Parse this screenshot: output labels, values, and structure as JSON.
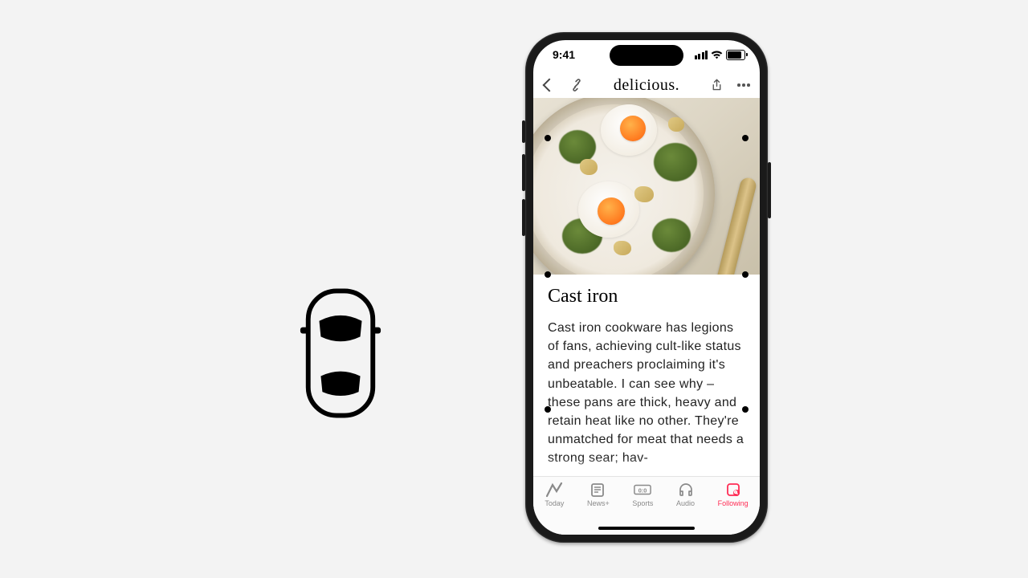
{
  "status": {
    "time": "9:41"
  },
  "nav": {
    "title": "delicious."
  },
  "article": {
    "heading": "Cast iron",
    "body": "Cast iron cookware has legions of fans, achieving cult-like status and preachers proclaiming it's unbeatable. I can see why – these pans are thick, heavy and retain heat like no other. They're unmatched for meat that needs a strong sear; hav-"
  },
  "tabs": [
    {
      "label": "Today"
    },
    {
      "label": "News+"
    },
    {
      "label": "Sports"
    },
    {
      "label": "Audio"
    },
    {
      "label": "Following"
    }
  ]
}
